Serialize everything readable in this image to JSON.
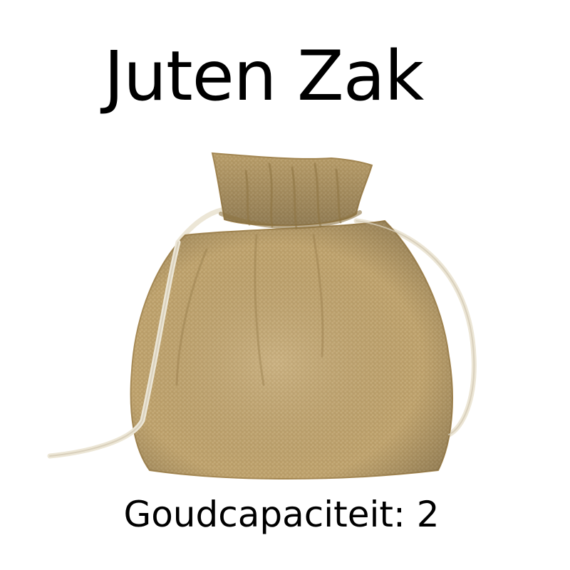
{
  "card": {
    "title": "Juten Zak",
    "stat_text": "Goudcapaciteit: 2",
    "item_icon": "jute-drawstring-bag-icon",
    "colors": {
      "background": "#ffffff",
      "text": "#000000",
      "jute": "#c9ae7a",
      "jute_shadow": "#a88b56",
      "cord": "#ece6d6"
    }
  }
}
